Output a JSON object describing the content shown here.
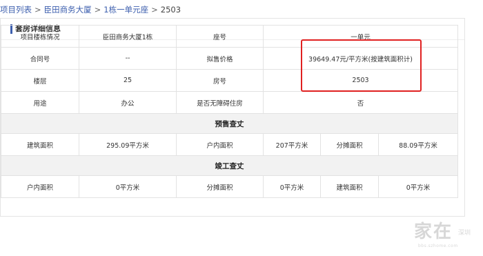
{
  "breadcrumb": {
    "items": [
      "项目列表",
      "臣田商务大厦",
      "1栋一单元座"
    ],
    "separator": ">",
    "current": "2503"
  },
  "panel": {
    "title": "套房详细信息"
  },
  "info_rows": [
    {
      "label1": "项目楼栋情况",
      "value1": "臣田商务大厦1栋",
      "label2": "座号",
      "value2": "一单元"
    },
    {
      "label1": "合同号",
      "value1": "--",
      "label2": "拟售价格",
      "value2": "39649.47元/平方米(按建筑面积计)"
    },
    {
      "label1": "楼层",
      "value1": "25",
      "label2": "房号",
      "value2": "2503"
    },
    {
      "label1": "用途",
      "value1": "办公",
      "label2": "是否无障碍住房",
      "value2": "否"
    }
  ],
  "presale": {
    "title": "预售查丈",
    "cells": [
      {
        "label": "建筑面积",
        "value": "295.09平方米"
      },
      {
        "label": "户内面积",
        "value": "207平方米"
      },
      {
        "label": "分摊面积",
        "value": "88.09平方米"
      }
    ]
  },
  "completion": {
    "title": "竣工查丈",
    "cells": [
      {
        "label": "户内面积",
        "value": "0平方米"
      },
      {
        "label": "分摊面积",
        "value": "0平方米"
      },
      {
        "label": "建筑面积",
        "value": "0平方米"
      }
    ]
  },
  "watermark": {
    "main": "家在",
    "city": "深圳",
    "url": "bbs.szhome.com"
  },
  "colors": {
    "link": "#3d5fae",
    "highlight": "#e02020",
    "section_bg": "#f2f2f2",
    "border": "#e2e2e2"
  }
}
